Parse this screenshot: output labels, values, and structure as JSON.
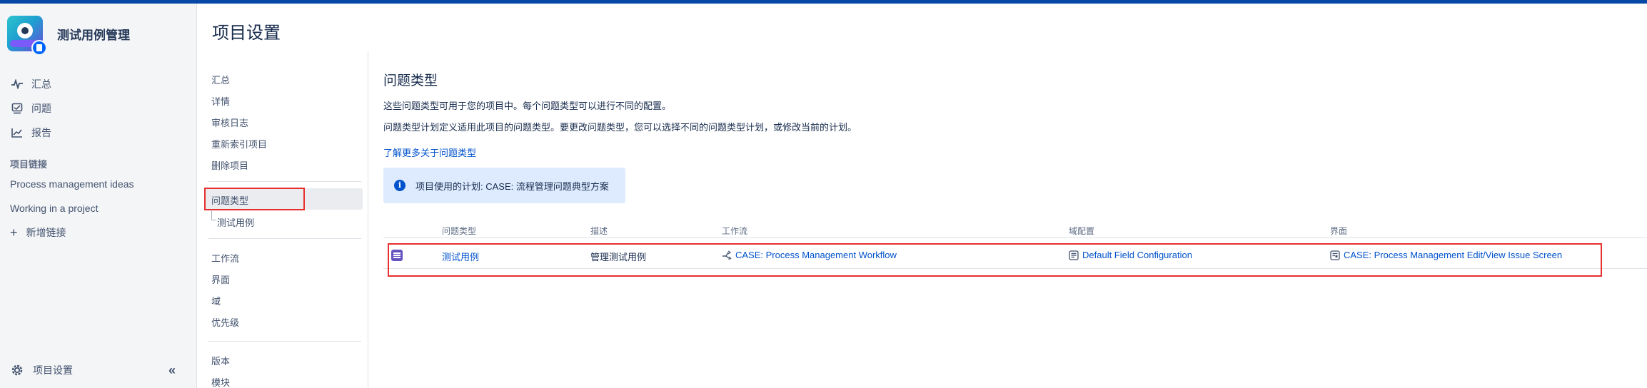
{
  "colors": {
    "accent": "#0052cc",
    "highlight_border": "#e5302e",
    "issue_type_color": "#6554c0",
    "top_bar": "#0747a6"
  },
  "sidebar": {
    "project_name": "测试用例管理",
    "nav": [
      {
        "label": "汇总",
        "icon": "pulse-icon"
      },
      {
        "label": "问题",
        "icon": "issues-icon"
      },
      {
        "label": "报告",
        "icon": "chart-icon"
      }
    ],
    "links_title": "项目链接",
    "links": [
      {
        "label": "Process management ideas"
      },
      {
        "label": "Working in a project"
      },
      {
        "label": "新增链接",
        "icon": "plus-icon"
      }
    ],
    "footer_label": "项目设置",
    "collapse_icon": "double-chevron-left-icon"
  },
  "page": {
    "title": "项目设置"
  },
  "settings_nav": {
    "group1": [
      "汇总",
      "详情",
      "审核日志",
      "重新索引项目",
      "删除项目"
    ],
    "active": "问题类型",
    "active_sub": "测试用例",
    "group2": [
      "工作流",
      "界面",
      "域",
      "优先级"
    ],
    "group3": [
      "版本",
      "模块"
    ]
  },
  "main": {
    "title": "问题类型",
    "desc1": "这些问题类型可用于您的项目中。每个问题类型可以进行不同的配置。",
    "desc2": "问题类型计划定义适用此项目的问题类型。要更改问题类型，您可以选择不同的问题类型计划，或修改当前的计划。",
    "learn_more": "了解更多关于问题类型",
    "info": "项目使用的计划: CASE: 流程管理问题典型方案",
    "table": {
      "headers": [
        "问题类型",
        "描述",
        "工作流",
        "域配置",
        "界面"
      ],
      "rows": [
        {
          "issue_type": "测试用例",
          "description": "管理测试用例",
          "workflow": "CASE: Process Management Workflow",
          "field_config": "Default Field Configuration",
          "screen": "CASE: Process Management Edit/View Issue Screen"
        }
      ]
    }
  }
}
